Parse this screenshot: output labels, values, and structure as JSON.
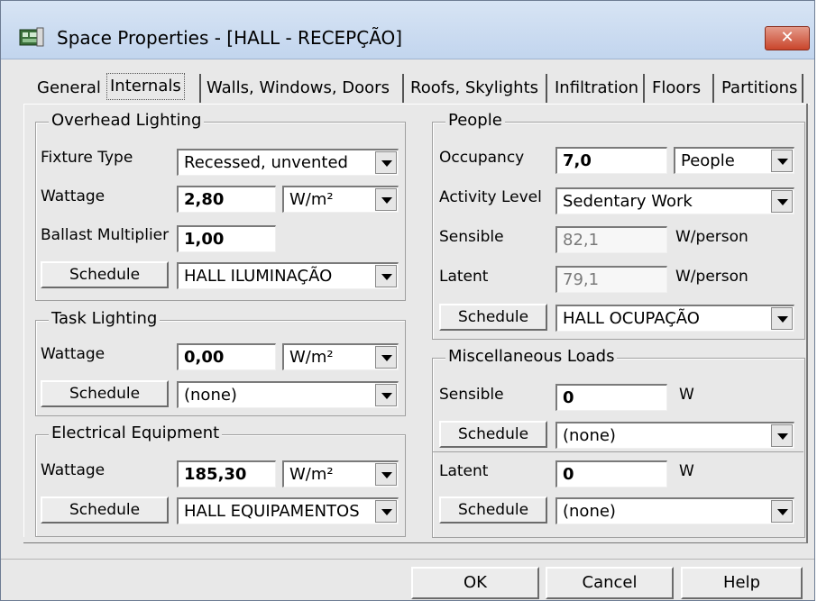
{
  "window": {
    "title": "Space Properties - [HALL - RECEPÇÃO]",
    "close_label": "✕"
  },
  "tabs": [
    {
      "label": "General"
    },
    {
      "label": "Internals"
    },
    {
      "label": "Walls, Windows, Doors"
    },
    {
      "label": "Roofs, Skylights"
    },
    {
      "label": "Infiltration"
    },
    {
      "label": "Floors"
    },
    {
      "label": "Partitions"
    }
  ],
  "overhead": {
    "title": "Overhead Lighting",
    "fixture_label": "Fixture Type",
    "fixture_value": "Recessed, unvented",
    "wattage_label": "Wattage",
    "wattage_value": "2,80",
    "wattage_unit": "W/m²",
    "ballast_label": "Ballast Multiplier",
    "ballast_value": "1,00",
    "schedule_label": "Schedule",
    "schedule_value": "HALL ILUMINAÇÃO"
  },
  "task": {
    "title": "Task Lighting",
    "wattage_label": "Wattage",
    "wattage_value": "0,00",
    "wattage_unit": "W/m²",
    "schedule_label": "Schedule",
    "schedule_value": "(none)"
  },
  "equipment": {
    "title": "Electrical Equipment",
    "wattage_label": "Wattage",
    "wattage_value": "185,30",
    "wattage_unit": "W/m²",
    "schedule_label": "Schedule",
    "schedule_value": "HALL EQUIPAMENTOS"
  },
  "people": {
    "title": "People",
    "occupancy_label": "Occupancy",
    "occupancy_value": "7,0",
    "occupancy_unit": "People",
    "activity_label": "Activity Level",
    "activity_value": "Sedentary Work",
    "sensible_label": "Sensible",
    "sensible_value": "82,1",
    "sensible_unit": "W/person",
    "latent_label": "Latent",
    "latent_value": "79,1",
    "latent_unit": "W/person",
    "schedule_label": "Schedule",
    "schedule_value": "HALL OCUPAÇÃO"
  },
  "misc": {
    "title": "Miscellaneous Loads",
    "sensible_label": "Sensible",
    "sensible_value": "0",
    "sensible_unit": "W",
    "sensible_schedule_label": "Schedule",
    "sensible_schedule_value": "(none)",
    "latent_label": "Latent",
    "latent_value": "0",
    "latent_unit": "W",
    "latent_schedule_label": "Schedule",
    "latent_schedule_value": "(none)"
  },
  "buttons": {
    "ok": "OK",
    "cancel": "Cancel",
    "help": "Help"
  }
}
